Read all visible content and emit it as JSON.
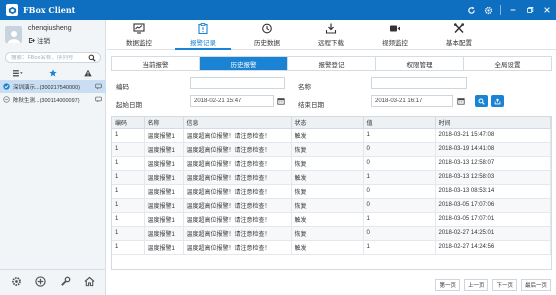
{
  "app": {
    "title": "FBox Client"
  },
  "user": {
    "name": "chenqiusheng",
    "logout_label": "注销"
  },
  "search": {
    "placeholder": "搜索：FBox名称、序列号"
  },
  "devices": [
    {
      "name": "深圳演示...(300217540000)",
      "active": true
    },
    {
      "name": "陈秋生测...(300114000097)",
      "active": false
    }
  ],
  "toolbar": [
    {
      "label": "数据监控",
      "icon": "monitor-icon"
    },
    {
      "label": "报警记录",
      "icon": "alarm-clipboard-icon",
      "active": true
    },
    {
      "label": "历史数据",
      "icon": "history-clock-icon"
    },
    {
      "label": "远程下载",
      "icon": "download-icon"
    },
    {
      "label": "视频监控",
      "icon": "video-camera-icon"
    },
    {
      "label": "基本配置",
      "icon": "tools-icon"
    }
  ],
  "subtabs": [
    {
      "label": "当前报警"
    },
    {
      "label": "历史报警",
      "active": true
    },
    {
      "label": "报警登记"
    },
    {
      "label": "权限管理"
    },
    {
      "label": "全局设置"
    }
  ],
  "form": {
    "code_label": "编码",
    "name_label": "名称",
    "start_label": "起始日期",
    "start_value": "2018-02-21 15:47",
    "end_label": "结束日期",
    "end_value": "2018-03-21 16:17"
  },
  "table": {
    "headers": [
      "编码",
      "名称",
      "信息",
      "状态",
      "值",
      "时间"
    ],
    "rows": [
      [
        "1",
        "温度报警1",
        "温度超高位报警！请注意检查！",
        "触发",
        "1",
        "2018-03-21 15:47:08"
      ],
      [
        "1",
        "温度报警1",
        "温度超高位报警！请注意检查！",
        "恢复",
        "0",
        "2018-03-19 14:41:08"
      ],
      [
        "1",
        "温度报警1",
        "温度超高位报警！请注意检查！",
        "恢复",
        "0",
        "2018-03-13 12:58:07"
      ],
      [
        "1",
        "温度报警1",
        "温度超高位报警！请注意检查！",
        "触发",
        "1",
        "2018-03-13 12:58:03"
      ],
      [
        "1",
        "温度报警1",
        "温度超高位报警！请注意检查！",
        "恢复",
        "0",
        "2018-03-13 08:53:14"
      ],
      [
        "1",
        "温度报警1",
        "温度超高位报警！请注意检查！",
        "恢复",
        "0",
        "2018-03-05 17:07:06"
      ],
      [
        "1",
        "温度报警1",
        "温度超高位报警！请注意检查！",
        "触发",
        "1",
        "2018-03-05 17:07:01"
      ],
      [
        "1",
        "温度报警1",
        "温度超高位报警！请注意检查！",
        "恢复",
        "0",
        "2018-02-27 14:25:01"
      ],
      [
        "1",
        "温度报警1",
        "温度超高位报警！请注意检查！",
        "触发",
        "1",
        "2018-02-27 14:24:56"
      ]
    ]
  },
  "pager": {
    "first": "第一页",
    "prev": "上一页",
    "next": "下一页",
    "last": "最后一页"
  },
  "colors": {
    "accent": "#1a83d3",
    "titlebar": "#0e6fc1"
  }
}
